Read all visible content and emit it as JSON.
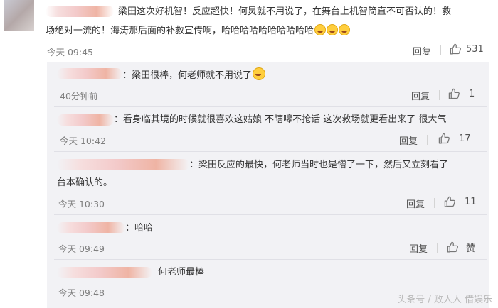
{
  "main_comment": {
    "line1": "梁田这次好机智！反应超快！何炅就不用说了，在舞台上机智简直不可否认的！救",
    "line2": "场绝对一流的！海涛那后面的补救宣传啊，哈哈哈哈哈哈哈哈哈哈",
    "time": "今天 09:45",
    "reply_label": "回复",
    "likes": "531"
  },
  "replies": [
    {
      "text": "：梁田很棒，何老师就不用说了",
      "time": "40分钟前",
      "reply_label": "回复",
      "likes": "1"
    },
    {
      "text": "：看身临其境的时候就很喜欢这姑娘 不瞎嗥不抢话 这次救场就更看出来了 很大气",
      "time": "今天 10:42",
      "reply_label": "回复",
      "likes": "17"
    },
    {
      "text": "：梁田反应的最快，何老师当时也是懵了一下，然后又立刻看了",
      "text2": "台本确认的。",
      "time": "今天 10:30",
      "reply_label": "回复",
      "likes": "11"
    },
    {
      "text": "：哈哈",
      "time": "今天 09:49",
      "reply_label": "回复",
      "likes": "赞"
    },
    {
      "text": "何老师最棒",
      "time": "今天 09:48"
    }
  ],
  "watermark": "头条号 / 败人人 借娱乐"
}
